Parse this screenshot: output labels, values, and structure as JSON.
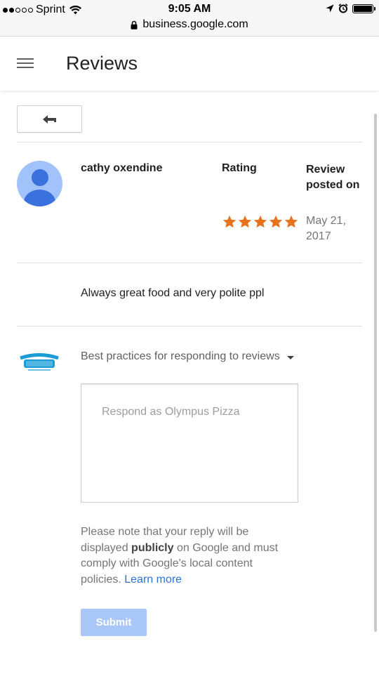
{
  "status_bar": {
    "carrier": "Sprint",
    "signal_bars_filled": 2,
    "signal_bars_total": 5,
    "time": "9:05 AM",
    "url": "business.google.com",
    "battery_level": 1.0
  },
  "header": {
    "title": "Reviews"
  },
  "review": {
    "reviewer_name": "cathy oxendine",
    "rating_label": "Rating",
    "rating_stars": 5,
    "rating_max": 5,
    "posted_label": "Review posted on",
    "posted_date": "May 21, 2017",
    "text": "Always great food and very polite ppl"
  },
  "response": {
    "business_logo_text_top": "OLYMPUS",
    "business_logo_text_main": "PIZZA",
    "best_practices_label": "Best practices for responding to reviews",
    "placeholder": "Respond as Olympus Pizza",
    "note_before": "Please note that your reply will be displayed ",
    "note_bold": "publicly",
    "note_after": " on Google and must comply with Google's local content policies. ",
    "learn_more": "Learn more",
    "submit_label": "Submit"
  },
  "colors": {
    "star": "#e8711c",
    "avatar_bg": "#a1c2fa",
    "avatar_fg": "#3b71dd",
    "link": "#2a73dd",
    "submit_disabled_bg": "#a9c7f8",
    "logo_blue": "#1a9cd8"
  },
  "icons": {
    "menu": "hamburger-icon",
    "back": "back-arrow-icon",
    "star": "star-icon",
    "dropdown": "caret-down-icon",
    "lock": "lock-icon",
    "wifi": "wifi-icon",
    "location": "location-arrow-icon",
    "alarm": "alarm-icon",
    "battery": "battery-icon"
  }
}
